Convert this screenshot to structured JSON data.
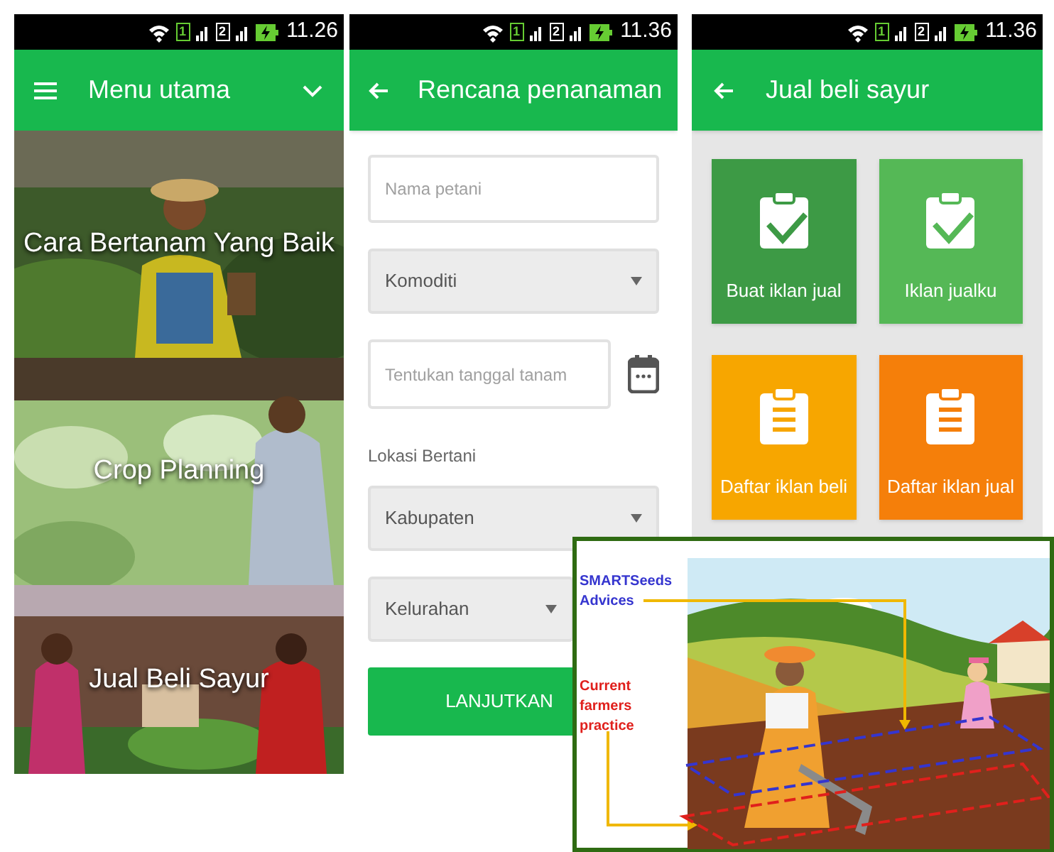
{
  "screens": [
    {
      "kind": "menu",
      "status_bar": {
        "sims": [
          "1",
          "2"
        ],
        "time": "11.26"
      },
      "header": {
        "kind": "menu",
        "title": "Menu utama"
      },
      "tiles": [
        {
          "kind": "farmer",
          "label": "Cara Bertanam Yang Baik"
        },
        {
          "kind": "crops",
          "label": "Crop Planning"
        },
        {
          "kind": "market",
          "label": "Jual Beli Sayur"
        }
      ]
    },
    {
      "kind": "form",
      "status_bar": {
        "sims": [
          "1",
          "2"
        ],
        "time": "11.36"
      },
      "header": {
        "kind": "back",
        "title": "Rencana penanaman"
      },
      "fields": [
        {
          "kind": "text",
          "placeholder": "Nama petani"
        },
        {
          "kind": "select",
          "value": "Komoditi"
        },
        {
          "kind": "date",
          "placeholder": "Tentukan tanggal tanam"
        },
        {
          "kind": "label",
          "text": "Lokasi Bertani"
        },
        {
          "kind": "select",
          "value": "Kabupaten"
        },
        {
          "kind": "select",
          "value": "Kelurahan"
        }
      ],
      "button": "LANJUTKAN"
    },
    {
      "kind": "grid",
      "status_bar": {
        "sims": [
          "1",
          "2"
        ],
        "time": "11.36"
      },
      "header": {
        "kind": "back",
        "title": "Jual beli sayur"
      },
      "tiles": [
        {
          "kind": "check",
          "label": "Buat iklan jual",
          "color": "#3d9a45"
        },
        {
          "kind": "check",
          "label": "Iklan jualku",
          "color": "#55b856"
        },
        {
          "kind": "list",
          "label": "Daftar iklan beli",
          "color": "#f7a600"
        },
        {
          "kind": "list",
          "label": "Daftar iklan jual",
          "color": "#f57f0a"
        }
      ]
    }
  ],
  "inset": {
    "labels": [
      {
        "kind": "advice",
        "text": "SMARTSeeds Advices",
        "color": "#3535cf"
      },
      {
        "kind": "current",
        "text": "Current farmers practice",
        "color": "#e0201c"
      }
    ]
  }
}
